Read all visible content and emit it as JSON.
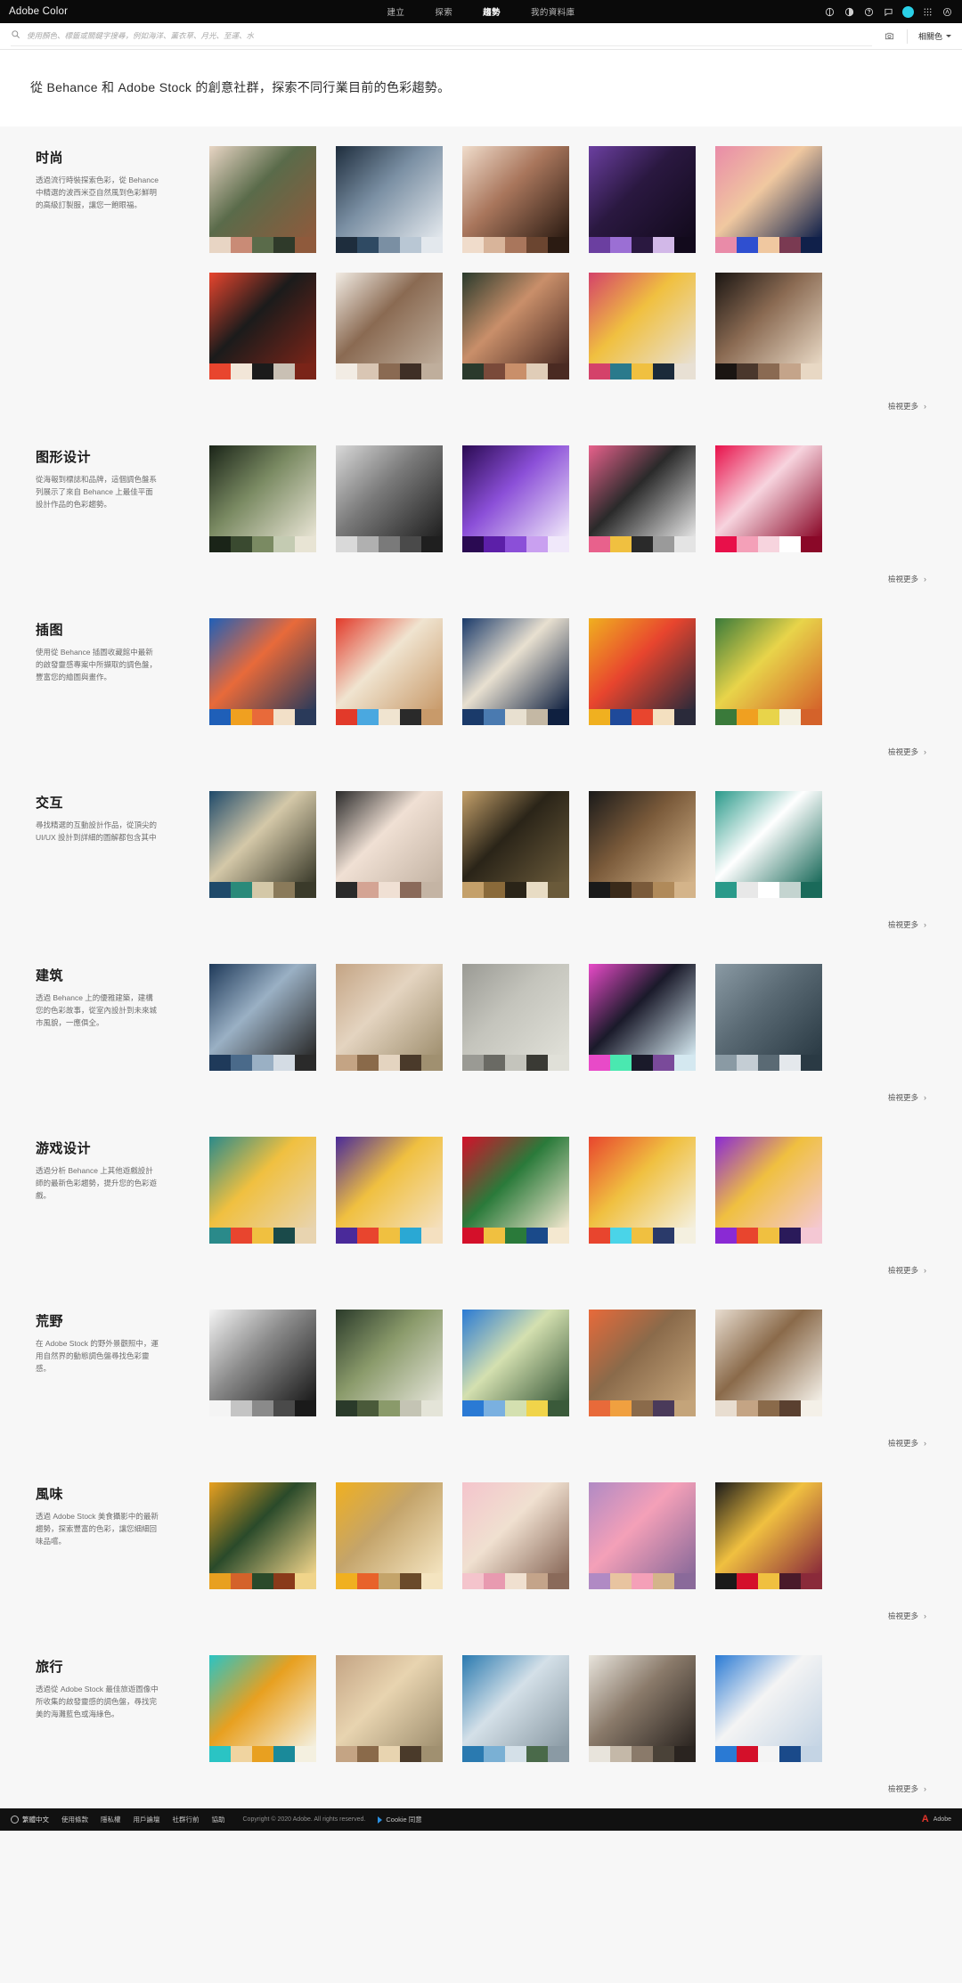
{
  "header": {
    "brand": "Adobe Color",
    "nav": [
      {
        "label": "建立",
        "active": false
      },
      {
        "label": "探索",
        "active": false
      },
      {
        "label": "趨勢",
        "active": true
      },
      {
        "label": "我的資料庫",
        "active": false
      }
    ],
    "icons": [
      "color-wheel-icon",
      "contrast-icon",
      "help-icon",
      "feedback-icon",
      "avatar",
      "apps-grid-icon",
      "adobe-logo-icon"
    ]
  },
  "search": {
    "placeholder": "使用顏色、標籤或關鍵字搜尋，例如海洋、薰衣草、月光、至運、水",
    "value": "",
    "camera_icon": "camera-icon",
    "scope_label": "相關色",
    "search_icon": "search-icon"
  },
  "intro": {
    "text": "從 Behance 和 Adobe Stock 的創意社群，探索不同行業目前的色彩趨勢。"
  },
  "more_label": "檢視更多",
  "sections": [
    {
      "id": "fashion",
      "title": "时尚",
      "desc": "透過流行時裝探索色彩，從 Behance 中精選的波西米亞自然風到色彩鮮明的高級訂製服，讓您一飽眼福。",
      "rows": [
        [
          {
            "name": "fashion-portrait-floral",
            "swatches": [
              "#e8d5c4",
              "#c98b76",
              "#5a6b4a",
              "#2f3a2a",
              "#8f5a3c"
            ]
          },
          {
            "name": "fashion-denim-jacket",
            "swatches": [
              "#1e2d3d",
              "#2f4a63",
              "#7a8fa3",
              "#b9c7d4",
              "#e3e8ed"
            ]
          },
          {
            "name": "fashion-earring-profile",
            "swatches": [
              "#f0dccb",
              "#d8b49a",
              "#a9765c",
              "#6b4530",
              "#2b1b12"
            ]
          },
          {
            "name": "fashion-purple-gloves",
            "swatches": [
              "#6b3fa0",
              "#9b6fd4",
              "#2a1840",
              "#d2b8e8",
              "#120a1c"
            ]
          },
          {
            "name": "fashion-blue-eyeshadow",
            "swatches": [
              "#e98ba8",
              "#2f4fd0",
              "#f0c8a0",
              "#7a3a52",
              "#10204a"
            ]
          }
        ],
        [
          {
            "name": "fashion-red-circle-hat",
            "swatches": [
              "#e8452e",
              "#f2e6d8",
              "#1b1b1b",
              "#c9c0b4",
              "#7a2418"
            ]
          },
          {
            "name": "fashion-trio-white",
            "swatches": [
              "#f2ece4",
              "#d9c6b4",
              "#8a6a52",
              "#3f2f26",
              "#bfae9c"
            ]
          },
          {
            "name": "fashion-floral-couple",
            "swatches": [
              "#2a3a2c",
              "#7a4a3a",
              "#c98f6a",
              "#e0cdb8",
              "#4a2a22"
            ]
          },
          {
            "name": "fashion-pattern-pair",
            "swatches": [
              "#d4426a",
              "#2a7a8c",
              "#f0c040",
              "#1b2a3a",
              "#e8e0d4"
            ]
          },
          {
            "name": "fashion-nude-portrait",
            "swatches": [
              "#1a1512",
              "#4a372c",
              "#8a6a52",
              "#c4a48a",
              "#e8d8c4"
            ]
          }
        ]
      ]
    },
    {
      "id": "graphic-design",
      "title": "图形设计",
      "desc": "從海報到標誌和品牌，這個調色盤系列展示了來自 Behance 上最佳平面設計作品的色彩趨勢。",
      "rows": [
        [
          {
            "name": "graphic-bottle-dark",
            "swatches": [
              "#1a2418",
              "#3a4a30",
              "#7a8a62",
              "#c4cbb2",
              "#e8e4d4"
            ]
          },
          {
            "name": "graphic-grey-grid",
            "swatches": [
              "#d9d9d9",
              "#b0b0b0",
              "#7a7a7a",
              "#4a4a4a",
              "#1f1f1f"
            ]
          },
          {
            "name": "graphic-logo-types",
            "swatches": [
              "#2a0a52",
              "#5c1fa8",
              "#8b4fd8",
              "#c9a0f0",
              "#f0e8fa"
            ]
          },
          {
            "name": "graphic-book-cover",
            "swatches": [
              "#e8618c",
              "#f0c040",
              "#2a2a2a",
              "#9a9a9a",
              "#e4e4e4"
            ]
          },
          {
            "name": "graphic-adobe-pink",
            "swatches": [
              "#e8104a",
              "#f4a0b8",
              "#f7d4de",
              "#ffffff",
              "#8a0828"
            ]
          }
        ]
      ]
    },
    {
      "id": "illustration",
      "title": "插图",
      "desc": "使用從 Behance 插圖收藏館中最新的啟發靈感專案中所擷取的調色盤，豐富您的繪圖與畫作。",
      "rows": [
        [
          {
            "name": "illustration-hand-window",
            "swatches": [
              "#1f5fb8",
              "#f0a020",
              "#e86a3a",
              "#f2e0c8",
              "#2a3a5a"
            ]
          },
          {
            "name": "illustration-poster-red",
            "swatches": [
              "#e23a2a",
              "#4aa8e0",
              "#f0e4d0",
              "#2a2a2a",
              "#c89a6a"
            ]
          },
          {
            "name": "illustration-blue-abstract",
            "swatches": [
              "#1a3a6a",
              "#4a7ab0",
              "#e8e0d0",
              "#c4b8a4",
              "#0f2040"
            ]
          },
          {
            "name": "illustration-yellow-hat",
            "swatches": [
              "#f0b020",
              "#1f4a9a",
              "#e8452e",
              "#f4e0c0",
              "#2a2a3a"
            ]
          },
          {
            "name": "illustration-mango",
            "swatches": [
              "#3a7a3a",
              "#f0a020",
              "#e8d44a",
              "#f4f0e0",
              "#d4622a"
            ]
          }
        ]
      ]
    },
    {
      "id": "interaction",
      "title": "交互",
      "desc": "尋找精選的互動設計作品，從頂尖的 UI/UX 設計到詳細的圖解都包含其中",
      "rows": [
        [
          {
            "name": "interaction-ambush-workshop",
            "swatches": [
              "#1f4a6a",
              "#2a8a7a",
              "#d4c8a8",
              "#8a7a5a",
              "#3a3a2a"
            ]
          },
          {
            "name": "interaction-manufacturer",
            "swatches": [
              "#2a2a2a",
              "#d4a494",
              "#f0e0d4",
              "#8a6a5a",
              "#c4b4a4"
            ]
          },
          {
            "name": "interaction-louvre",
            "swatches": [
              "#c4a06a",
              "#8a6a3a",
              "#2a2418",
              "#e8dcc4",
              "#6a5a3a"
            ]
          },
          {
            "name": "interaction-sdt-dark",
            "swatches": [
              "#1a1a1a",
              "#3a2a1a",
              "#7a5a3a",
              "#b08a5a",
              "#d4b48a"
            ]
          },
          {
            "name": "interaction-web-mockup",
            "swatches": [
              "#2a9a8a",
              "#e8e8e8",
              "#ffffff",
              "#c4d4d0",
              "#1a6a5a"
            ]
          }
        ]
      ]
    },
    {
      "id": "architecture",
      "title": "建筑",
      "desc": "透過 Behance 上的優雅建築，建構您的色彩故事，從室內設計到未來城市風貌，一應俱全。",
      "rows": [
        [
          {
            "name": "architecture-modern-house",
            "swatches": [
              "#1f3a5a",
              "#4a6a8a",
              "#9ab0c4",
              "#d4dce4",
              "#2a2a2a"
            ]
          },
          {
            "name": "architecture-interior-warm",
            "swatches": [
              "#c4a484",
              "#8a6a4a",
              "#e4d4c0",
              "#4a3a2a",
              "#a09070"
            ]
          },
          {
            "name": "architecture-athens",
            "swatches": [
              "#9a9a94",
              "#6a6a64",
              "#c4c4bc",
              "#3a3a34",
              "#e0e0d8"
            ]
          },
          {
            "name": "architecture-pink-facade",
            "swatches": [
              "#e84ac8",
              "#4ae8b0",
              "#1a1a2a",
              "#7a4a9a",
              "#d4e8f0"
            ]
          },
          {
            "name": "architecture-pool-villa",
            "swatches": [
              "#8a9aa4",
              "#c4cdd4",
              "#5a6a74",
              "#e4e8ec",
              "#2a3a44"
            ]
          }
        ]
      ]
    },
    {
      "id": "game-design",
      "title": "游戏设计",
      "desc": "透過分析 Behance 上其他遊戲設計師的最新色彩趨勢，提升您的色彩遊戲。",
      "rows": [
        [
          {
            "name": "game-teal-character",
            "swatches": [
              "#2a8a8a",
              "#e8452e",
              "#f0c040",
              "#1a4a4a",
              "#e8d4b0"
            ]
          },
          {
            "name": "game-cartoon-dog",
            "swatches": [
              "#4a2a9a",
              "#e8452e",
              "#f0c040",
              "#2aa8d4",
              "#f4e0c0"
            ]
          },
          {
            "name": "game-royal-charm",
            "swatches": [
              "#d4102a",
              "#f0c040",
              "#2a7a3a",
              "#1a4a8a",
              "#f4e8d0"
            ]
          },
          {
            "name": "game-flights",
            "swatches": [
              "#e8452e",
              "#4ad4e8",
              "#f0c040",
              "#2a3a6a",
              "#f4f0e0"
            ]
          },
          {
            "name": "game-lanterns",
            "swatches": [
              "#8a2ad4",
              "#e8452e",
              "#f0c040",
              "#2a1a5a",
              "#f4c8d4"
            ]
          }
        ]
      ]
    },
    {
      "id": "wilderness",
      "title": "荒野",
      "desc": "在 Adobe Stock 的野外景觀照中，運用自然界的動態調色盤尋找色彩靈感。",
      "rows": [
        [
          {
            "name": "wilderness-explore-snow",
            "swatches": [
              "#f4f4f4",
              "#c4c4c4",
              "#8a8a8a",
              "#4a4a4a",
              "#1a1a1a"
            ]
          },
          {
            "name": "wilderness-forest",
            "swatches": [
              "#2a3a2a",
              "#4a5a3a",
              "#8a9a6a",
              "#c4c4b4",
              "#e4e4d8"
            ]
          },
          {
            "name": "wilderness-mountain-lake",
            "swatches": [
              "#2a7ad4",
              "#7ab0e0",
              "#d4e0b0",
              "#f0d44a",
              "#3a5a3a"
            ]
          },
          {
            "name": "wilderness-desert-cactus",
            "swatches": [
              "#e86a3a",
              "#f0a040",
              "#8a6a4a",
              "#4a3a5a",
              "#c4a47a"
            ]
          },
          {
            "name": "wilderness-dune",
            "swatches": [
              "#e8ddd0",
              "#c4a484",
              "#8a6a4a",
              "#5a4030",
              "#f4f0e8"
            ]
          }
        ]
      ]
    },
    {
      "id": "flavor",
      "title": "風味",
      "desc": "透過 Adobe Stock 美食攝影中的最新趨勢，探索豐富的色彩，讓您細細回味品嚐。",
      "rows": [
        [
          {
            "name": "flavor-spiced-dish",
            "swatches": [
              "#e8a020",
              "#d4622a",
              "#2a4a2a",
              "#8a3a1a",
              "#f0d48a"
            ]
          },
          {
            "name": "flavor-spices-bowl",
            "swatches": [
              "#f0b020",
              "#e8622a",
              "#c4a46a",
              "#6a4a2a",
              "#f4e4c0"
            ]
          },
          {
            "name": "flavor-pink-dessert",
            "swatches": [
              "#f4c4cc",
              "#e89ab0",
              "#f0e0d0",
              "#c4a48a",
              "#8a6a5a"
            ]
          },
          {
            "name": "flavor-ice-cream-cones",
            "swatches": [
              "#b08ac4",
              "#e8c4a0",
              "#f4a0b8",
              "#d4b48a",
              "#8a6a9a"
            ]
          },
          {
            "name": "flavor-dark-berries",
            "swatches": [
              "#1a1a1a",
              "#d4102a",
              "#f0c040",
              "#4a1a2a",
              "#8a2a3a"
            ]
          }
        ]
      ]
    },
    {
      "id": "travel",
      "title": "旅行",
      "desc": "透過從 Adobe Stock 最佳旅遊圖像中所收集的啟發靈感的調色盤，尋找完美的海灘藍色或海綠色。",
      "rows": [
        [
          {
            "name": "travel-beach-aerial",
            "swatches": [
              "#2ac4c4",
              "#f0d4a0",
              "#e8a020",
              "#1a8a9a",
              "#f4f0e0"
            ]
          },
          {
            "name": "travel-couple-autumn",
            "swatches": [
              "#c4a484",
              "#8a6a4a",
              "#e8d4b0",
              "#4a3a2a",
              "#a09070"
            ]
          },
          {
            "name": "travel-lake-mountain",
            "swatches": [
              "#2a7ab0",
              "#7ab0d4",
              "#d4e0e8",
              "#4a6a4a",
              "#8a9aa4"
            ]
          },
          {
            "name": "travel-airport-walk",
            "swatches": [
              "#e8e4dc",
              "#c4b8a8",
              "#8a7a6a",
              "#4a4238",
              "#2a2420"
            ]
          },
          {
            "name": "travel-santorini-red",
            "swatches": [
              "#2a7ad4",
              "#d4102a",
              "#f4f4f4",
              "#1a4a8a",
              "#c4d4e4"
            ]
          }
        ]
      ]
    }
  ],
  "footer": {
    "language": "繁體中文",
    "links": [
      "使用條款",
      "隱私權",
      "用戶論壇",
      "社群行前",
      "協助"
    ],
    "copyright": "Copyright © 2020 Adobe. All rights reserved.",
    "cookie_label": "Cookie 同意",
    "adobe_label": "Adobe"
  },
  "colors": {
    "topbar_bg": "#0a0a0a",
    "page_bg": "#f7f7f7",
    "accent": "#2ad1e8",
    "adobe_red": "#e4352b"
  }
}
